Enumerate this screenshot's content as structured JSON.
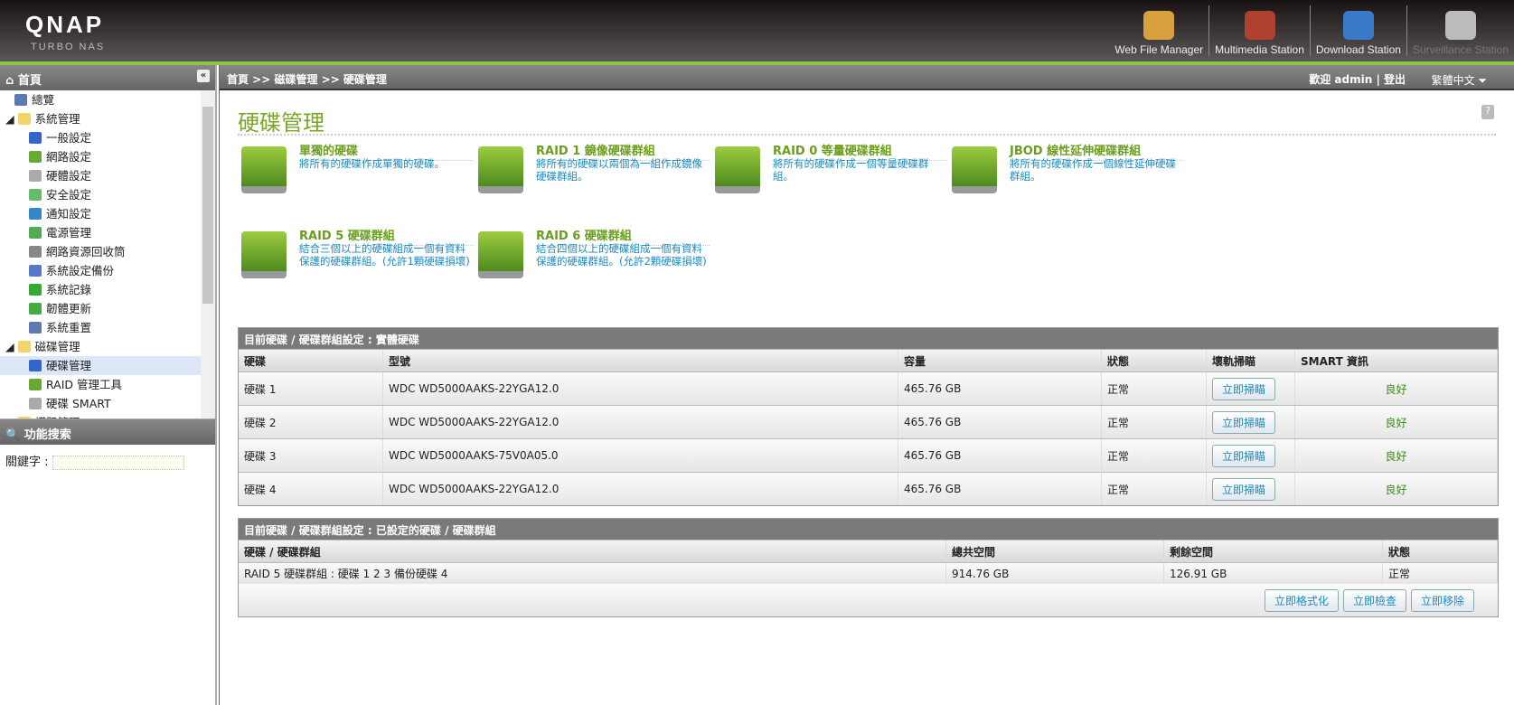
{
  "header": {
    "logo": "QNAP",
    "sublogo": "TURBO NAS",
    "apps": [
      {
        "label": "Web File Manager",
        "icon": "web-file-manager-icon"
      },
      {
        "label": "Multimedia Station",
        "icon": "multimedia-station-icon"
      },
      {
        "label": "Download Station",
        "icon": "download-station-icon"
      },
      {
        "label": "Surveillance Station",
        "icon": "surveillance-station-icon"
      }
    ]
  },
  "sidebar": {
    "title": "首頁",
    "items": [
      {
        "label": "總覽",
        "level": 0
      },
      {
        "label": "系統管理",
        "level": -1
      },
      {
        "label": "一般設定",
        "level": 1
      },
      {
        "label": "網路設定",
        "level": 1
      },
      {
        "label": "硬體設定",
        "level": 1
      },
      {
        "label": "安全設定",
        "level": 1
      },
      {
        "label": "通知設定",
        "level": 1
      },
      {
        "label": "電源管理",
        "level": 1
      },
      {
        "label": "網路資源回收筒",
        "level": 1
      },
      {
        "label": "系統設定備份",
        "level": 1
      },
      {
        "label": "系統記錄",
        "level": 1
      },
      {
        "label": "韌體更新",
        "level": 1
      },
      {
        "label": "系統重置",
        "level": 1
      },
      {
        "label": "磁碟管理",
        "level": -1
      },
      {
        "label": "硬碟管理",
        "level": 1,
        "selected": true
      },
      {
        "label": "RAID 管理工具",
        "level": 1
      },
      {
        "label": "硬碟 SMART",
        "level": 1
      },
      {
        "label": "權限管理",
        "level": -1
      }
    ],
    "search_title": "功能搜索",
    "keyword_label": "關鍵字 :",
    "keyword_value": ""
  },
  "breadcrumb": "首頁 >> 磁碟管理 >> 硬碟管理",
  "welcome": "歡迎 admin | 登出",
  "language": "繁體中文",
  "page_title": "硬碟管理",
  "options": [
    {
      "title": "單獨的硬碟",
      "desc": "將所有的硬碟作成單獨的硬碟。"
    },
    {
      "title": "RAID 1 鏡像硬碟群組",
      "desc": "將所有的硬碟以兩個為一組作成鏡像硬碟群組。"
    },
    {
      "title": "RAID 0 等量硬碟群組",
      "desc": "將所有的硬碟作成一個等量硬碟群組。"
    },
    {
      "title": "JBOD 線性延伸硬碟群組",
      "desc": "將所有的硬碟作成一個線性延伸硬碟群組。"
    },
    {
      "title": "RAID 5 硬碟群組",
      "desc": "結合三個以上的硬碟組成一個有資料保護的硬碟群組。(允許1顆硬碟損壞)"
    },
    {
      "title": "RAID 6 硬碟群組",
      "desc": "結合四個以上的硬碟組成一個有資料保護的硬碟群組。(允許2顆硬碟損壞)"
    }
  ],
  "disks": {
    "caption": "目前硬碟 / 硬碟群組設定 : 實體硬碟",
    "headers": [
      "硬碟",
      "型號",
      "容量",
      "狀態",
      "壞軌掃瞄",
      "SMART 資訊"
    ],
    "rows": [
      {
        "disk": "硬碟 1",
        "model": "WDC WD5000AAKS-22YGA12.0",
        "size": "465.76 GB",
        "status": "正常",
        "scan": "立即掃瞄",
        "smart": "良好"
      },
      {
        "disk": "硬碟 2",
        "model": "WDC WD5000AAKS-22YGA12.0",
        "size": "465.76 GB",
        "status": "正常",
        "scan": "立即掃瞄",
        "smart": "良好"
      },
      {
        "disk": "硬碟 3",
        "model": "WDC WD5000AAKS-75V0A05.0",
        "size": "465.76 GB",
        "status": "正常",
        "scan": "立即掃瞄",
        "smart": "良好"
      },
      {
        "disk": "硬碟 4",
        "model": "WDC WD5000AAKS-22YGA12.0",
        "size": "465.76 GB",
        "status": "正常",
        "scan": "立即掃瞄",
        "smart": "良好"
      }
    ]
  },
  "volumes": {
    "caption": "目前硬碟 / 硬碟群組設定 : 已設定的硬碟 / 硬碟群組",
    "headers": [
      "硬碟 / 硬碟群組",
      "總共空間",
      "剩餘空間",
      "狀態"
    ],
    "rows": [
      {
        "name": "RAID 5 硬碟群組 : 硬碟 1 2 3 備份硬碟 4",
        "total": "914.76 GB",
        "free": "126.91 GB",
        "status": "正常"
      }
    ],
    "buttons": [
      "立即格式化",
      "立即檢查",
      "立即移除"
    ]
  }
}
